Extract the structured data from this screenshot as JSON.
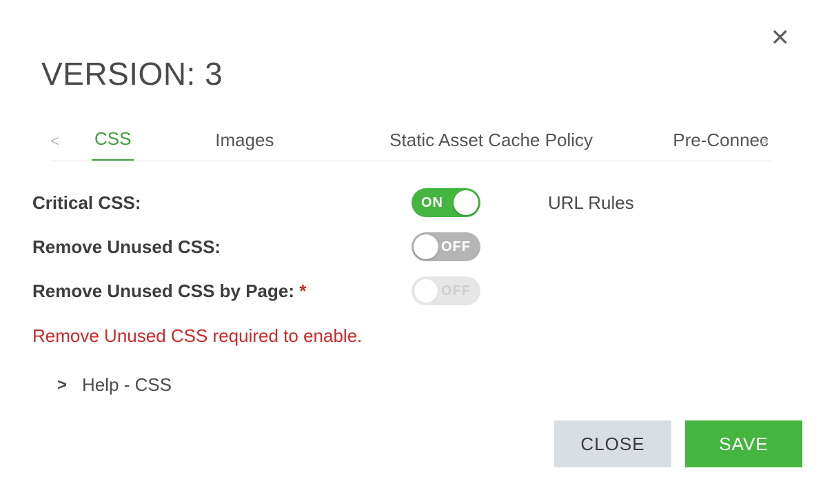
{
  "title": "VERSION: 3",
  "close_icon_glyph": "✕",
  "tabs": {
    "prev_glyph": "<",
    "next_glyph": ">",
    "items": [
      "CSS",
      "Images",
      "Static Asset Cache Policy",
      "Pre-Connec"
    ],
    "active_index": 0
  },
  "settings": {
    "critical_css": {
      "label": "Critical CSS:",
      "state": "on",
      "on_text": "ON",
      "extra_label": "URL Rules"
    },
    "remove_unused_css": {
      "label": "Remove Unused CSS:",
      "state": "off",
      "off_text": "OFF"
    },
    "remove_unused_css_by_page": {
      "label": "Remove Unused CSS by Page: ",
      "required_marker": "*",
      "state": "disabled",
      "off_text": "OFF"
    }
  },
  "warning_text": "Remove Unused CSS required to enable.",
  "help": {
    "chevron": ">",
    "label": "Help - CSS"
  },
  "buttons": {
    "close": "CLOSE",
    "save": "SAVE"
  }
}
